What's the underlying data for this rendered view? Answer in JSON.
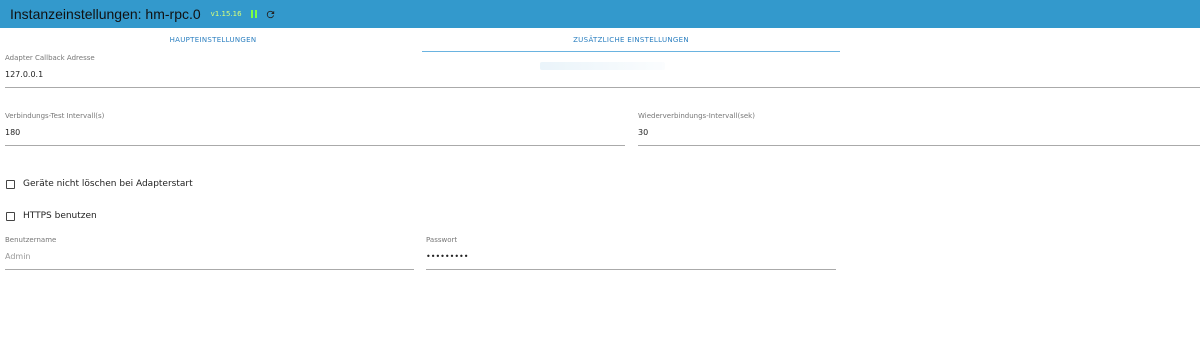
{
  "header": {
    "title": "Instanzeinstellungen: hm-rpc.0",
    "version": "v1.15.16"
  },
  "tabs": [
    {
      "label": "HAUPTEINSTELLUNGEN",
      "active": false
    },
    {
      "label": "ZUSÄTZLICHE EINSTELLUNGEN",
      "active": true
    }
  ],
  "fields": {
    "callback_address": {
      "label": "Adapter Callback Adresse",
      "value": "127.0.0.1"
    },
    "test_interval": {
      "label": "Verbindungs-Test Intervall(s)",
      "value": "180"
    },
    "reconnect_interval": {
      "label": "Wiederverbindungs-Intervall(sek)",
      "value": "30"
    },
    "username": {
      "label": "Benutzername",
      "value": "",
      "placeholder": "Admin"
    },
    "password": {
      "label": "Passwort",
      "value": "•••••••••"
    }
  },
  "checkboxes": [
    {
      "label": "Geräte nicht löschen bei Adapterstart",
      "checked": false
    },
    {
      "label": "HTTPS benutzen",
      "checked": false
    }
  ],
  "icons": {
    "pause": "pause-icon",
    "reload": "reload-icon"
  },
  "colors": {
    "titlebar": "#3399cc",
    "tab_text": "#2b7fc0",
    "version": "#d7ff7a",
    "pause": "#7cff44"
  }
}
